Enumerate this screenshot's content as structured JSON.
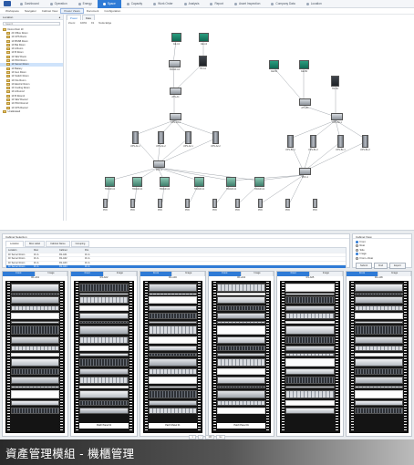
{
  "top_nav": {
    "items": [
      "Dashboard",
      "Operation",
      "Energy",
      "Space",
      "Capacity",
      "Work Order",
      "Analysis",
      "Report",
      "Asset Inspection",
      "Company Data",
      "Location"
    ],
    "active_index": 3
  },
  "sub_nav": {
    "items": [
      "Workspace",
      "Navigator",
      "Cabinet View",
      "Power Views",
      "Document",
      "Configuration"
    ],
    "active_index": 3
  },
  "left_panel": {
    "title": "Location",
    "search_placeholder": "Search",
    "tree": [
      "Demo Floor 1F",
      "2F Office Room",
      "1F UPS Room",
      "1F BSSB Room",
      "1F Bat Room",
      "1F A Room",
      "1F B Room",
      "1F SEV Room",
      "1F PDU Room",
      "1F Server Room",
      "1F Battery",
      "1F Gen Room",
      "1F Switch Room",
      "1F Fire Room",
      "1F Electric Room",
      "1F Cooling Room",
      "1F A Room2",
      "1F B Room2",
      "1F SEV Room2",
      "1F PDU Room2",
      "1F UPS Room2",
      "Unallocated"
    ],
    "selected_index": 9
  },
  "canvas": {
    "tabs": [
      "Power",
      "Data"
    ],
    "active_tab": 0,
    "toolbar": [
      "Zoom:",
      "100%",
      "Fit",
      "Node Edge"
    ],
    "labels": {
      "gen1": "GE-A1",
      "gen2": "GE-A2",
      "gen3": "GE-B1",
      "gen4": "GE-B2",
      "sw1": "SWGR-A1",
      "tr1": "TR-A1",
      "tr2": "TR-B1",
      "ats1": "ATS-A1",
      "ats2": "ATS-B1",
      "ups1": "UPS-A1-1",
      "ups2": "UPS-A1-2",
      "ups3": "UPS-A2-1",
      "ups4": "UPS-A2-2",
      "ups5": "UPS-B1-1",
      "ups6": "UPS-B1-2",
      "pdu": "PDU-1",
      "pdc": "PDC"
    }
  },
  "cabinet_filter": {
    "title": "Cabinet Selection",
    "tabs": [
      "Location",
      "Row Label",
      "Cabinet Name",
      "Grouping"
    ],
    "columns": [
      "Location",
      "Row",
      "Cabinet",
      "Pos"
    ],
    "rows": [
      [
        "1F Server Room",
        "1F-A",
        "R1-A01",
        "1F-A"
      ],
      [
        "1F Server Room",
        "1F-A",
        "R1-A02",
        "1F-A"
      ],
      [
        "1F Server Room",
        "1F-A",
        "R1-A03",
        "1F-A"
      ],
      [
        "1F Server Room",
        "1F-A",
        "R1-A04",
        "1F-A"
      ]
    ],
    "selected_row": 3
  },
  "view_panel": {
    "title": "Cabinet View",
    "options": [
      "Front",
      "Rear",
      "Side",
      "Image",
      "Front + Rear"
    ],
    "checked": [
      true,
      false,
      false,
      true,
      false
    ],
    "buttons": [
      "Submit",
      "Find",
      "Export"
    ]
  },
  "racks": [
    {
      "tabs": [
        "Front",
        "Image"
      ],
      "name": "R1-A01"
    },
    {
      "tabs": [
        "Front",
        "Image"
      ],
      "name": "R1-A02",
      "patch": "Patch Panel 01"
    },
    {
      "tabs": [
        "Front",
        "Image"
      ],
      "name": "R1-A03",
      "patch": "Patch Panel 01"
    },
    {
      "tabs": [
        "Front",
        "Image"
      ],
      "name": "R1-A04",
      "patch": "Patch Panel 01"
    },
    {
      "tabs": [
        "Front",
        "Image"
      ],
      "name": "R1-A05"
    },
    {
      "tabs": [
        "Front",
        "Image"
      ],
      "name": "R1-A06"
    }
  ],
  "pager": [
    "1",
    "/",
    "100",
    "Go"
  ],
  "caption": "資產管理模組 - 機櫃管理"
}
